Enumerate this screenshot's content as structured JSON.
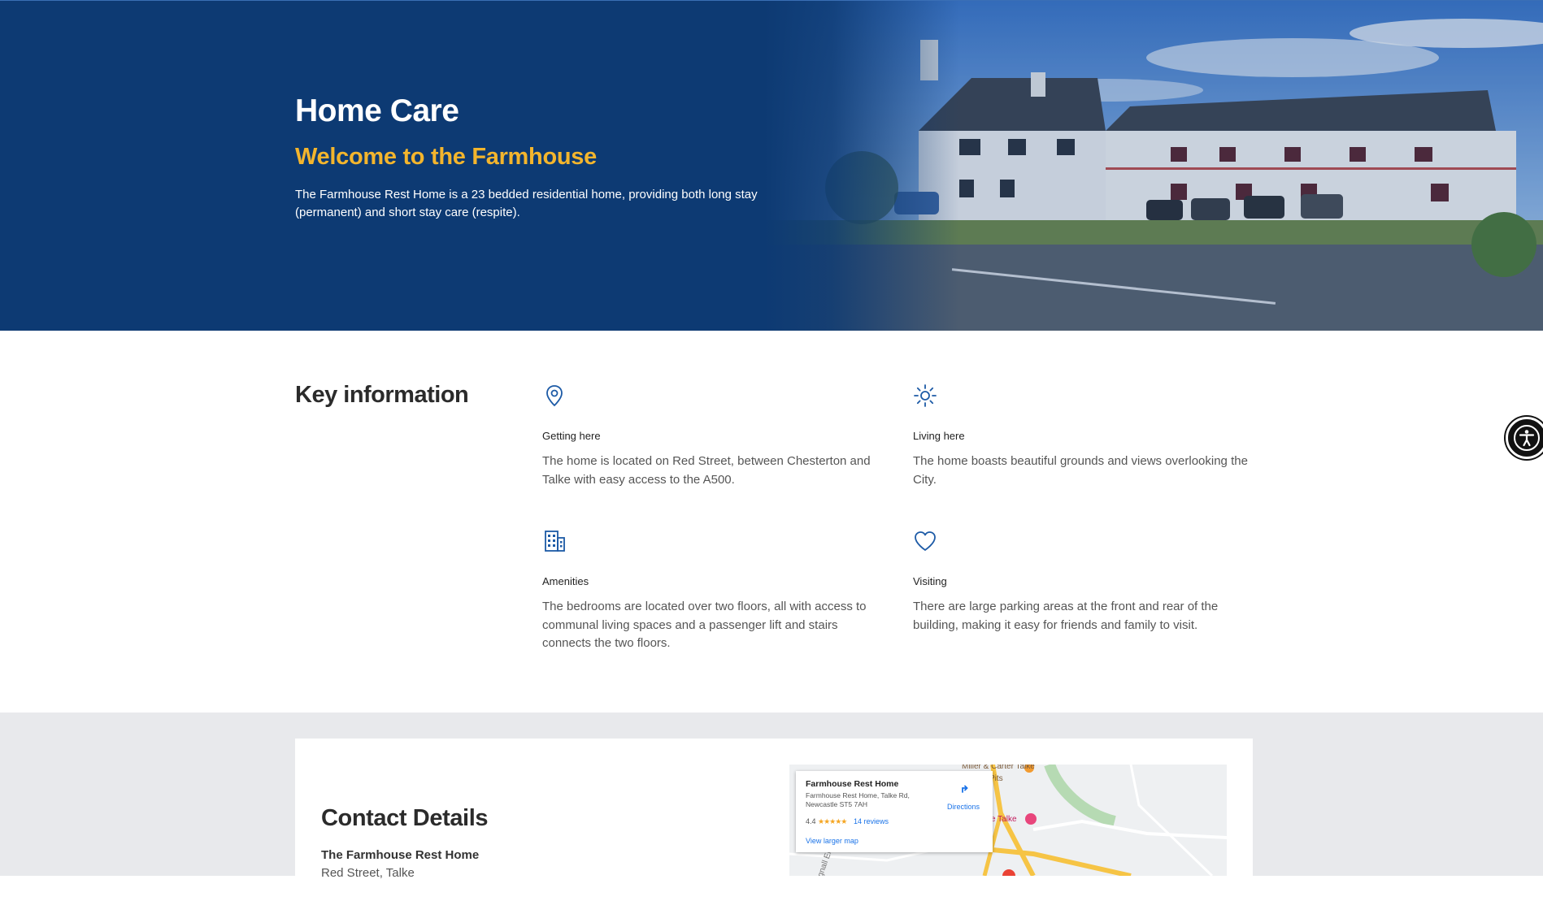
{
  "hero": {
    "title": "Home Care",
    "subtitle": "Welcome to the Farmhouse",
    "description": "The Farmhouse Rest Home is a 23 bedded residential home, providing both long stay (permanent) and short stay care (respite)."
  },
  "key_info": {
    "title": "Key information",
    "items": [
      {
        "icon": "location-pin-icon",
        "heading": "Getting here",
        "body": "The home is located on Red Street, between Chesterton and Talke with easy access to the A500."
      },
      {
        "icon": "sun-icon",
        "heading": "Living here",
        "body": "The home boasts beautiful grounds and views overlooking the City."
      },
      {
        "icon": "building-icon",
        "heading": "Amenities",
        "body": "The bedrooms are located over two floors, all with access to communal living spaces and a passenger lift and stairs connects the two floors."
      },
      {
        "icon": "heart-icon",
        "heading": "Visiting",
        "body": "There are large parking areas at the front and rear of the building, making it easy for friends and family to visit."
      }
    ]
  },
  "contact": {
    "title": "Contact Details",
    "name": "The Farmhouse Rest Home",
    "address_line": "Red Street, Talke"
  },
  "map": {
    "place_title": "Farmhouse Rest Home",
    "place_address": "Farmhouse Rest Home, Talke Rd, Newcastle ST5 7AH",
    "rating": "4.4",
    "stars": "★★★★★",
    "reviews": "14 reviews",
    "larger_map": "View larger map",
    "directions": "Directions",
    "labels": {
      "miller": "Miller & Carter Talke",
      "pits": "Pits",
      "talke": "e Talke",
      "road": "Bignall En"
    }
  },
  "colors": {
    "hero_bg": "#0d3a73",
    "accent_yellow": "#f3b52d",
    "icon_blue": "#1c5aa6",
    "contact_bg": "#e8e9ec"
  }
}
